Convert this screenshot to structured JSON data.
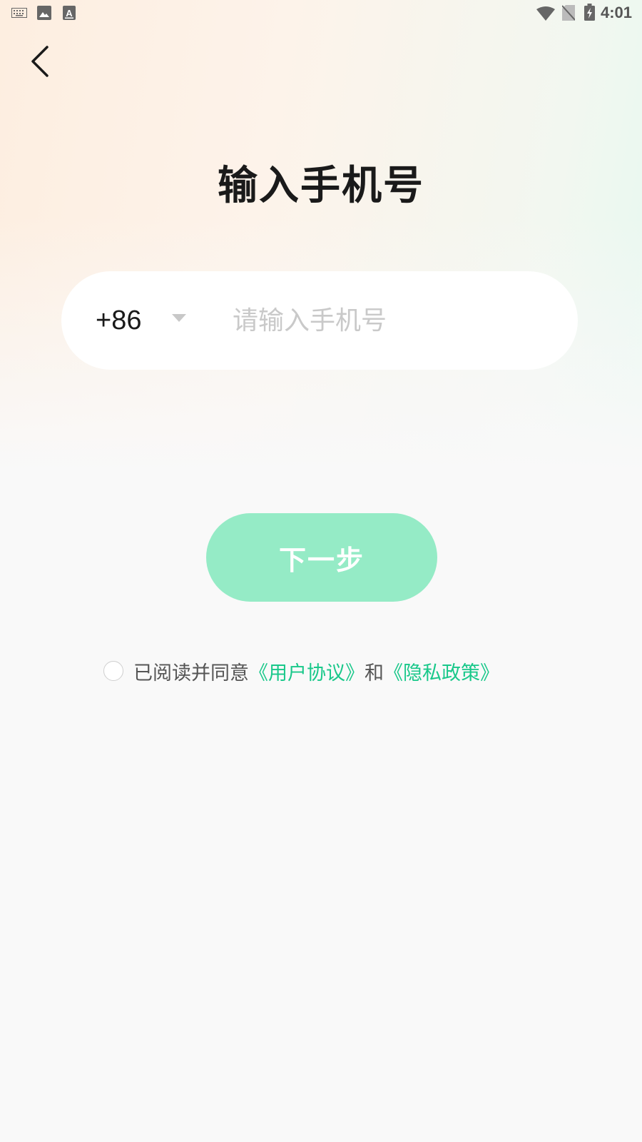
{
  "status_bar": {
    "time": "4:01",
    "left_icons": [
      "keyboard-icon",
      "image-icon",
      "font-icon"
    ],
    "right_icons": [
      "wifi-icon",
      "no-sim-icon",
      "battery-charging-icon"
    ]
  },
  "header": {
    "back_icon": "chevron-left-icon"
  },
  "title": "输入手机号",
  "phone": {
    "country_code": "+86",
    "placeholder": "请输入手机号",
    "value": ""
  },
  "next_button": {
    "label": "下一步",
    "color": "#95ebc6"
  },
  "agreement": {
    "checked": false,
    "prefix": "已阅读并同意",
    "user_agreement": "《用户协议》",
    "conjunction": "和",
    "privacy_policy": "《隐私政策》",
    "link_color": "#19c88a"
  }
}
